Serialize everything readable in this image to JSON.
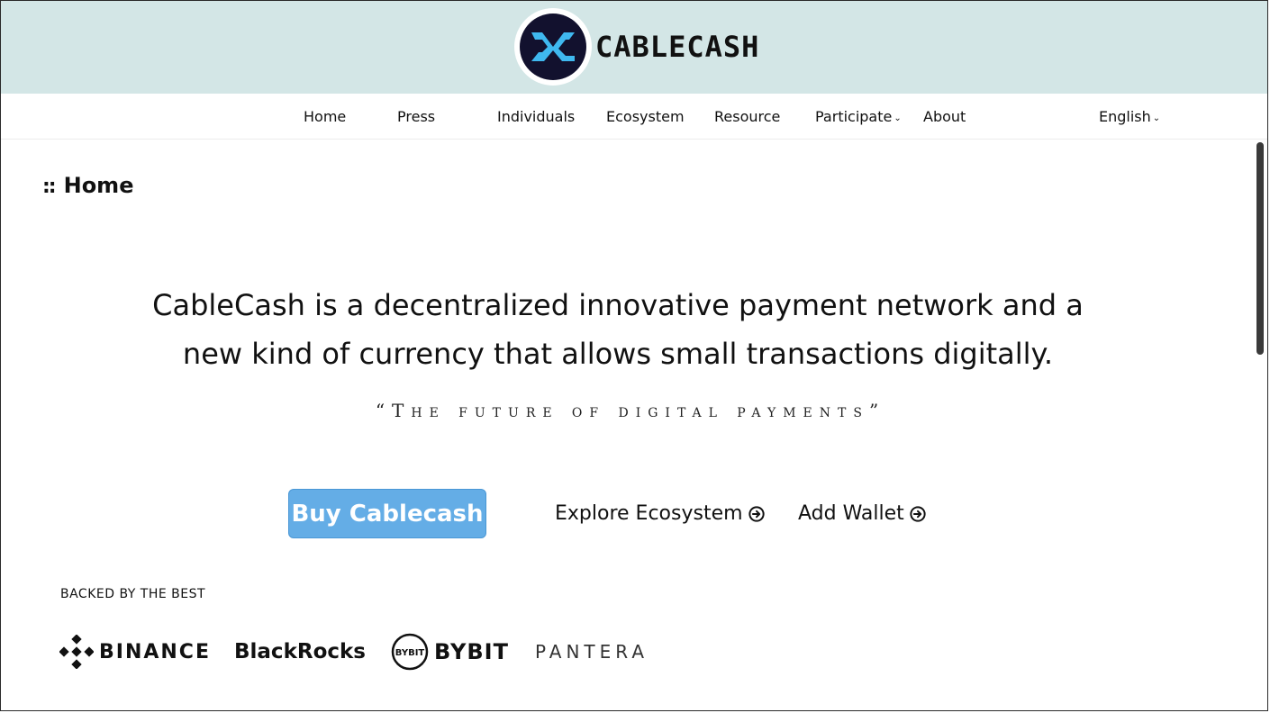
{
  "brand": {
    "name": "CABLECASH"
  },
  "nav": {
    "items": [
      {
        "label": "Home"
      },
      {
        "label": "Press"
      },
      {
        "label": "Individuals"
      },
      {
        "label": "Ecosystem"
      },
      {
        "label": "Resource"
      },
      {
        "label": "Participate"
      },
      {
        "label": "About"
      }
    ],
    "language": "English"
  },
  "page": {
    "title": "Home",
    "title_prefix": "::"
  },
  "hero": {
    "headline": "CableCash is a decentralized innovative payment network and a new kind of currency that allows small transactions digitally.",
    "tagline": "“The future of digital payments”"
  },
  "actions": {
    "buy_label": "Buy Cablecash",
    "explore_label": "Explore Ecosystem",
    "wallet_label": "Add Wallet"
  },
  "partners": {
    "heading": "BACKED BY THE BEST",
    "items": [
      {
        "name": "BINANCE"
      },
      {
        "name": "BlackRocks"
      },
      {
        "name": "BYBIT",
        "badge": "BYBIT"
      },
      {
        "name": "PANTERA"
      }
    ]
  },
  "colors": {
    "header_bg": "#d3e6e6",
    "buy_button": "#64ade6",
    "logo_bg": "#12112e",
    "logo_mark": "#3fb8ef"
  }
}
